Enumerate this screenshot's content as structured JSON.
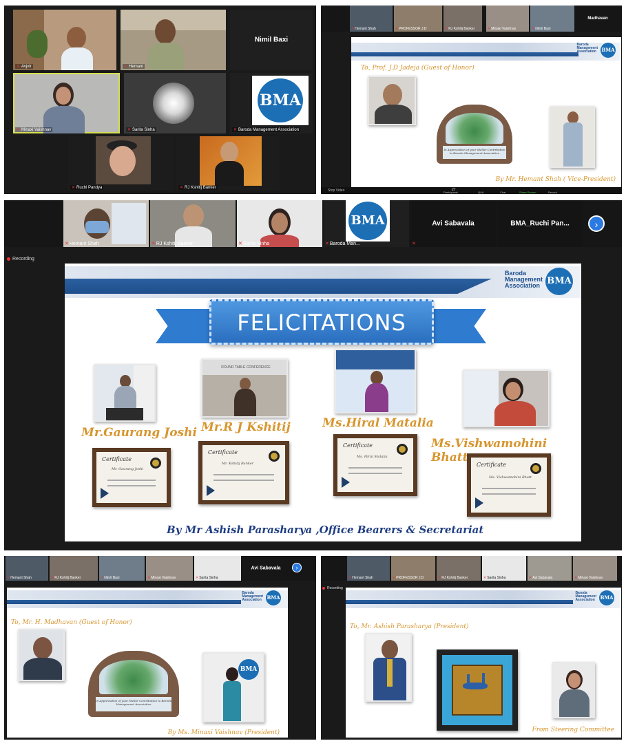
{
  "panel_top_left": {
    "tiles": [
      {
        "name": "Avjvir"
      },
      {
        "name": "Hemant"
      },
      {
        "name": "Nimil Baxi"
      },
      {
        "name": "Minaxi Vaishnav"
      },
      {
        "name": "Sarita Sinha"
      },
      {
        "name": "Baroda Management Association"
      },
      {
        "name": "Ruchi Pandya"
      },
      {
        "name": "RJ Kshitij Banker"
      }
    ],
    "logo_text": "BMA"
  },
  "panel_top_right": {
    "thumbs": [
      "Hemant Shah",
      "PROFESSOR J.D",
      "RJ Kshitij Banker",
      "Minaxi Vaishnav",
      "Nimil Baxi",
      "Madhavan"
    ],
    "brand": [
      "Baroda",
      "Management",
      "Association"
    ],
    "to_line": "To, Prof. J.D Jadeja (Guest of Honor)",
    "plaque_text": "In Appreciation of your Stellar Contribution to Baroda Management Association",
    "by_line": "By Mr. Hemant Shah ( Vice-President)",
    "toolbar": [
      "Stop Video",
      "Participants",
      "Q&A",
      "Chat",
      "Share Screen",
      "Record"
    ],
    "participants_count": "27"
  },
  "panel_main": {
    "thumbs": [
      "Hemant Shah",
      "RJ Kshitij Banker",
      "Sarita Sinha",
      "Baroda Man..."
    ],
    "name_tiles": [
      "Avi Sabavala",
      "BMA_Ruchi Pan..."
    ],
    "recording_label": "Recording",
    "brand": [
      "Baroda",
      "Management",
      "Association"
    ],
    "banner_title": "FELICITATIONS",
    "honorees": [
      {
        "name": "Mr.Gaurang Joshi",
        "cert_name": "Mr. Gaurang Joshi"
      },
      {
        "name": "Mr.R J Kshitij",
        "cert_name": "Mr. Kshitij Banker"
      },
      {
        "name": "Ms.Hiral Matalia",
        "cert_name": "Ms. Hiral Matalia"
      },
      {
        "name": "Ms.Vishwamohini Bhatt",
        "cert_name": "Ms. Vishwamohini Bhatt"
      }
    ],
    "certificate_label": "Certificate",
    "photo_caption_2": "ROUND TABLE CONFERENCE",
    "by_line": "By Mr Ashish Parasharya ,Office Bearers & Secretariat"
  },
  "panel_bottom_left": {
    "thumbs": [
      "Hemant Shah",
      "RJ Kshitij Banker",
      "Nimil Baxi",
      "Minaxi Vaishnav",
      "Sarita Sinha"
    ],
    "name_tile": "Avi Sabavala",
    "brand": [
      "Baroda",
      "Management",
      "Association"
    ],
    "to_line": "To, Mr. H. Madhavan (Guest of Honor)",
    "plaque_text": "In Appreciation of your Stellar Contribution to Baroda Management Association",
    "by_line": "By Ms. Minaxi Vaishnav (President)"
  },
  "panel_bottom_right": {
    "thumbs": [
      "Hemant Shah",
      "PROFESSOR J.D",
      "RJ Kshitij Banker",
      "Sarita Sinha",
      "Avi Sabavala",
      "Minaxi Vaishnav"
    ],
    "recording_label": "Recording",
    "brand": [
      "Baroda",
      "Management",
      "Association"
    ],
    "to_line": "To, Mr. Ashish Parasharya (President)",
    "by_line": "From Steering Committee"
  }
}
